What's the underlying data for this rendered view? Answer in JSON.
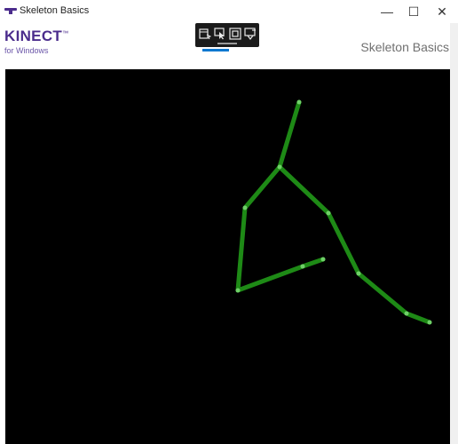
{
  "window": {
    "title": "Skeleton Basics",
    "controls": {
      "minimize": "—",
      "maximize": "☐",
      "close": "✕"
    },
    "app_icon": "kinect-sensor-icon"
  },
  "header": {
    "logo": {
      "brand": "KINECT",
      "sub": "for Windows"
    },
    "title": "Skeleton Basics"
  },
  "toolbar": {
    "icons": [
      "select-app-icon",
      "select-pointer-icon",
      "frame-capture-icon",
      "track-toggle-icon"
    ]
  },
  "colors": {
    "bone": "#1e8a16",
    "joint": "#6fd068",
    "canvas_bg": "#000000",
    "brand": "#4b2c8c"
  }
}
